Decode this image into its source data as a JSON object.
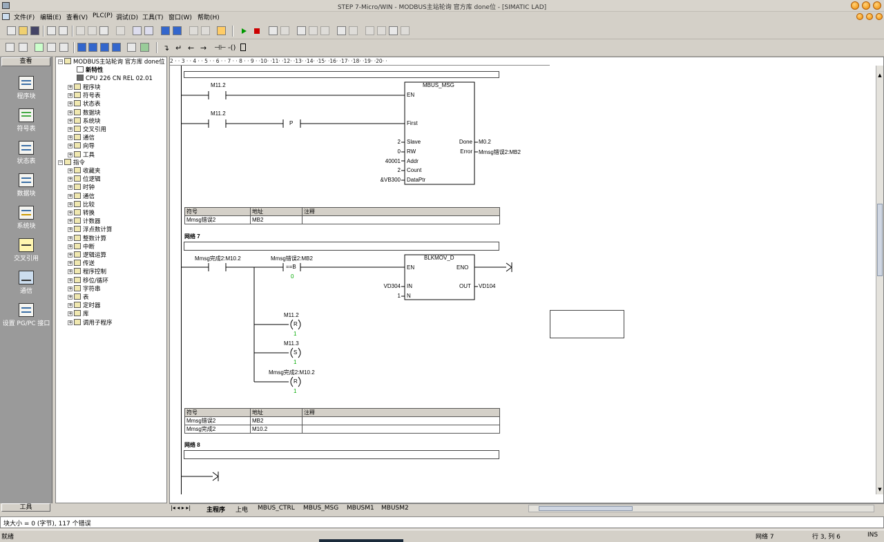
{
  "window": {
    "title": "STEP 7-Micro/WIN - MODBUS主站轮询 官方库 done位 - [SIMATIC LAD]"
  },
  "menu": [
    "文件(F)",
    "编辑(E)",
    "查看(V)",
    "PLC(P)",
    "调试(D)",
    "工具(T)",
    "窗口(W)",
    "帮助(H)"
  ],
  "nav": {
    "header": "查看",
    "footer": "工具",
    "items": [
      "程序块",
      "符号表",
      "状态表",
      "数据块",
      "系统块",
      "交叉引用",
      "通信",
      "设置 PG/PC 接口"
    ]
  },
  "tree": {
    "root": "MODBUS主站轮询 官方库 done位",
    "new_features": "新特性",
    "cpu": "CPU 226 CN REL 02.01",
    "project_items": [
      "程序块",
      "符号表",
      "状态表",
      "数据块",
      "系统块",
      "交叉引用",
      "通信",
      "向导",
      "工具"
    ],
    "instructions_label": "指令",
    "instruction_items": [
      "收藏夹",
      "位逻辑",
      "时钟",
      "通信",
      "比较",
      "转换",
      "计数器",
      "浮点数计算",
      "整数计算",
      "中断",
      "逻辑运算",
      "传送",
      "程序控制",
      "移位/循环",
      "字符串",
      "表",
      "定时器",
      "库",
      "调用子程序"
    ]
  },
  "ruler": "2 · · 3 · · 4 · · 5 · · 6 · · 7 · · 8 · · 9 · ·10· ·11· ·12· ·13· ·14· ·15· ·16· ·17· ·18· ·19· ·20· ·",
  "network6": {
    "contact1": "M11.2",
    "contact2": "M11.2",
    "edge": "P",
    "block": {
      "name": "MBUS_MSG",
      "inputs": [
        {
          "pin": "EN",
          "value": ""
        },
        {
          "pin": "First",
          "value": ""
        },
        {
          "pin": "Slave",
          "value": "2"
        },
        {
          "pin": "RW",
          "value": "0"
        },
        {
          "pin": "Addr",
          "value": "40001"
        },
        {
          "pin": "Count",
          "value": "2"
        },
        {
          "pin": "DataPtr",
          "value": "&VB300"
        }
      ],
      "outputs": [
        {
          "pin": "Done",
          "value": "M0.2"
        },
        {
          "pin": "Error",
          "value": "Mmsg错误2:MB2"
        }
      ]
    },
    "symbols": {
      "headers": [
        "符号",
        "地址",
        "注释"
      ],
      "rows": [
        [
          "Mmsg错误2",
          "MB2",
          ""
        ]
      ]
    }
  },
  "network7": {
    "title": "网络 7",
    "contact1": "Mmsg完成2:M10.2",
    "compare_label": "Mmsg错误2:MB2",
    "compare_op": "==B",
    "compare_value": "0",
    "block": {
      "name": "BLKMOV_D",
      "en": "EN",
      "eno": "ENO",
      "in_pin": "IN",
      "in_val": "VD304",
      "out_pin": "OUT",
      "out_val": "VD104",
      "n_pin": "N",
      "n_val": "1"
    },
    "coils": [
      {
        "addr": "M11.2",
        "op": "R",
        "n": "1"
      },
      {
        "addr": "M11.3",
        "op": "S",
        "n": "1"
      },
      {
        "addr": "Mmsg完成2:M10.2",
        "op": "R",
        "n": "1"
      }
    ],
    "symbols": {
      "headers": [
        "符号",
        "地址",
        "注释"
      ],
      "rows": [
        [
          "Mmsg错误2",
          "MB2",
          ""
        ],
        [
          "Mmsg完成2",
          "M10.2",
          ""
        ]
      ]
    }
  },
  "network8": {
    "title": "网络 8"
  },
  "tabs": [
    "主程序",
    "上电",
    "MBUS_CTRL",
    "MBUS_MSG",
    "MBUSM1",
    "MBUSM2"
  ],
  "message": "块大小 = 0 (字节), 117 个错误",
  "status": {
    "ready": "就绪",
    "network": "网络 7",
    "position": "行 3, 列 6",
    "mode": "INS"
  }
}
